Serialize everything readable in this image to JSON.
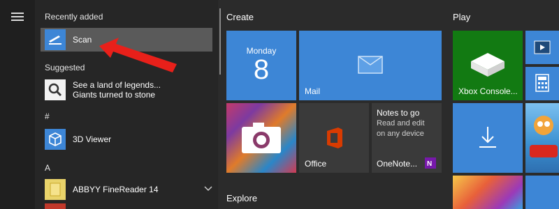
{
  "left_rail": {
    "menu_icon": "hamburger-icon"
  },
  "app_list": {
    "recently_added_header": "Recently added",
    "scan_label": "Scan",
    "suggested_header": "Suggested",
    "suggested_line1": "See a land of legends...",
    "suggested_line2": "Giants turned to stone",
    "hash_header": "#",
    "viewer_label": "3D Viewer",
    "a_header": "A",
    "abbyy_label": "ABBYY FineReader 14"
  },
  "groups": {
    "create": "Create",
    "play": "Play",
    "explore": "Explore"
  },
  "tiles": {
    "calendar_day": "Monday",
    "calendar_date": "8",
    "mail": "Mail",
    "office": "Office",
    "onenote_title": "Notes to go",
    "onenote_desc_line1": "Read and edit",
    "onenote_desc_line2": "on any device",
    "onenote_label": "OneNote...",
    "xbox": "Xbox Console..."
  },
  "colors": {
    "accent_blue": "#3d86d6",
    "xbox_green": "#127a12",
    "arrow_red": "#e8201a",
    "office_bg": "#3a3a3a"
  }
}
